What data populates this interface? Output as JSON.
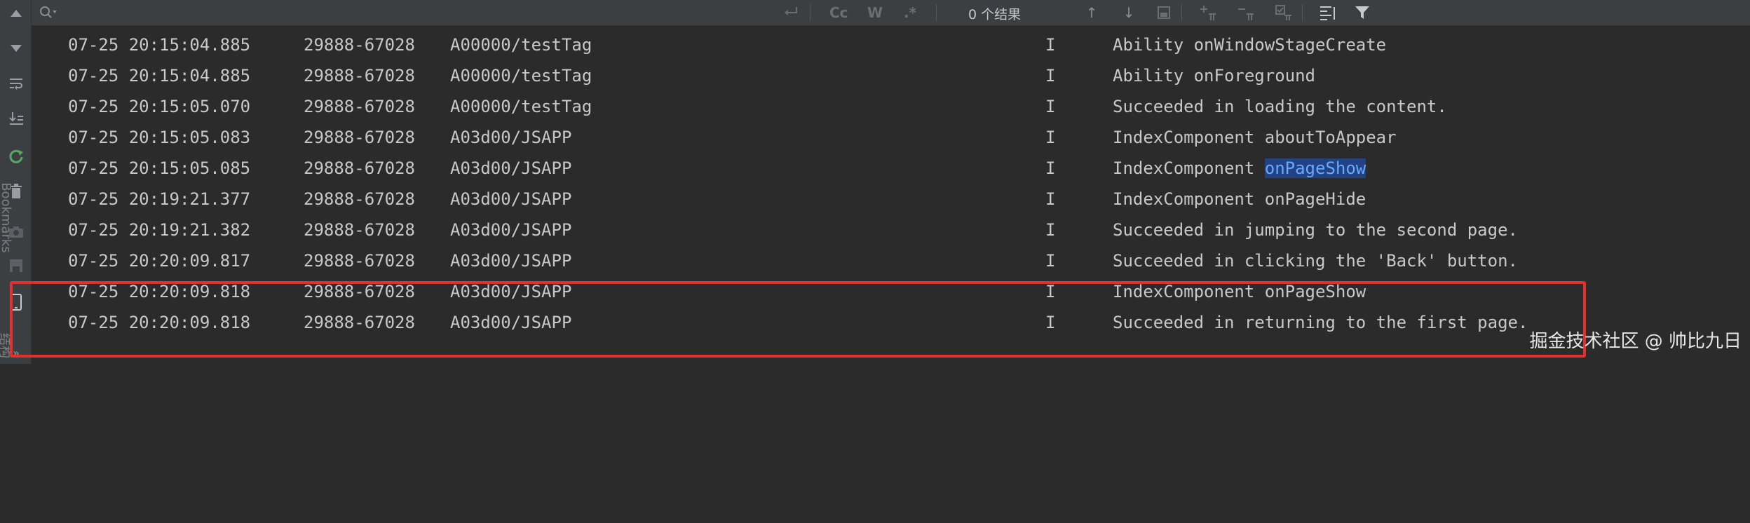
{
  "toolbar": {
    "search_placeholder": "",
    "regex_cc_label": "Cc",
    "words_label": "W",
    "regex_label": ".*",
    "results_label": "0 个结果"
  },
  "sidebar": {
    "bookmarks_label": "Bookmarks",
    "structure_label": "结构"
  },
  "log": {
    "rows": [
      {
        "date": "07-25 20:15:04.885",
        "pid": "29888-67028",
        "tag": "A00000/testTag",
        "level": "I",
        "message": "Ability onWindowStageCreate"
      },
      {
        "date": "07-25 20:15:04.885",
        "pid": "29888-67028",
        "tag": "A00000/testTag",
        "level": "I",
        "message": "Ability onForeground"
      },
      {
        "date": "07-25 20:15:05.070",
        "pid": "29888-67028",
        "tag": "A00000/testTag",
        "level": "I",
        "message": "Succeeded in loading the content."
      },
      {
        "date": "07-25 20:15:05.083",
        "pid": "29888-67028",
        "tag": "A03d00/JSAPP",
        "level": "I",
        "message": "IndexComponent aboutToAppear"
      },
      {
        "date": "07-25 20:15:05.085",
        "pid": "29888-67028",
        "tag": "A03d00/JSAPP",
        "level": "I",
        "message_prefix": "IndexComponent ",
        "message_highlight": "onPageShow"
      },
      {
        "date": "07-25 20:19:21.377",
        "pid": "29888-67028",
        "tag": "A03d00/JSAPP",
        "level": "I",
        "message": "IndexComponent onPageHide"
      },
      {
        "date": "07-25 20:19:21.382",
        "pid": "29888-67028",
        "tag": "A03d00/JSAPP",
        "level": "I",
        "message": "Succeeded in jumping to the second page."
      },
      {
        "date": "07-25 20:20:09.817",
        "pid": "29888-67028",
        "tag": "A03d00/JSAPP",
        "level": "I",
        "message": "Succeeded in clicking the 'Back' button."
      },
      {
        "date": "07-25 20:20:09.818",
        "pid": "29888-67028",
        "tag": "A03d00/JSAPP",
        "level": "I",
        "message": "IndexComponent onPageShow"
      },
      {
        "date": "07-25 20:20:09.818",
        "pid": "29888-67028",
        "tag": "A03d00/JSAPP",
        "level": "I",
        "message": "Succeeded in returning to the first page."
      }
    ]
  },
  "watermark": "掘金技术社区 @ 帅比九日",
  "colors": {
    "background": "#2b2b2b",
    "toolbar": "#3c3f41",
    "highlight_bg": "#214283",
    "annotation_red": "#e03131"
  }
}
